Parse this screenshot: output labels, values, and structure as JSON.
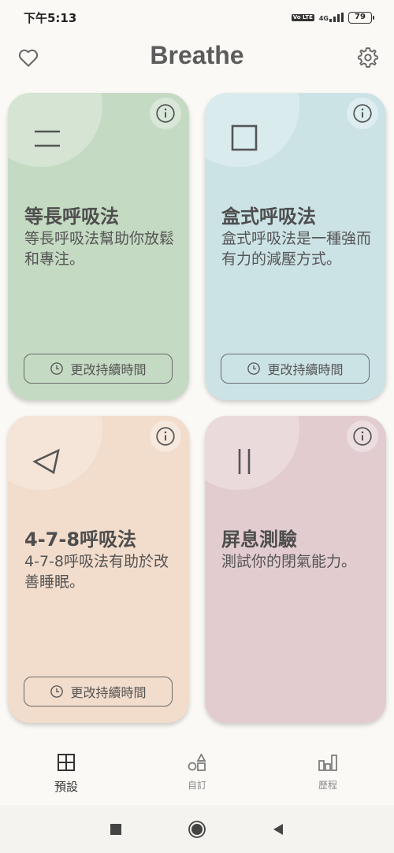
{
  "status_bar": {
    "time": "下午5:13",
    "volte": "Vo LTE",
    "network": "4G",
    "battery": "79"
  },
  "header": {
    "title": "Breathe"
  },
  "cards": [
    {
      "title": "等長呼吸法",
      "description": "等長呼吸法幫助你放鬆和專注。",
      "duration_button": "更改持續時間",
      "icon": "equal-lines-icon",
      "background": "#c5dac3"
    },
    {
      "title": "盒式呼吸法",
      "description": "盒式呼吸法是一種強而有力的減壓方式。",
      "duration_button": "更改持續時間",
      "icon": "square-icon",
      "background": "#cce3e6"
    },
    {
      "title": "4-7-8呼吸法",
      "description": "4-7-8呼吸法有助於改善睡眠。",
      "duration_button": "更改持續時間",
      "icon": "triangle-icon",
      "background": "#f2dccb"
    },
    {
      "title": "屏息測驗",
      "description": "測試你的閉氣能力。",
      "icon": "pause-icon",
      "background": "#e2cccf"
    }
  ],
  "bottom_nav": {
    "items": [
      {
        "label": "預設",
        "icon": "grid-icon",
        "active": true
      },
      {
        "label": "自訂",
        "icon": "shapes-icon",
        "active": false
      },
      {
        "label": "歷程",
        "icon": "bar-chart-icon",
        "active": false
      }
    ]
  }
}
